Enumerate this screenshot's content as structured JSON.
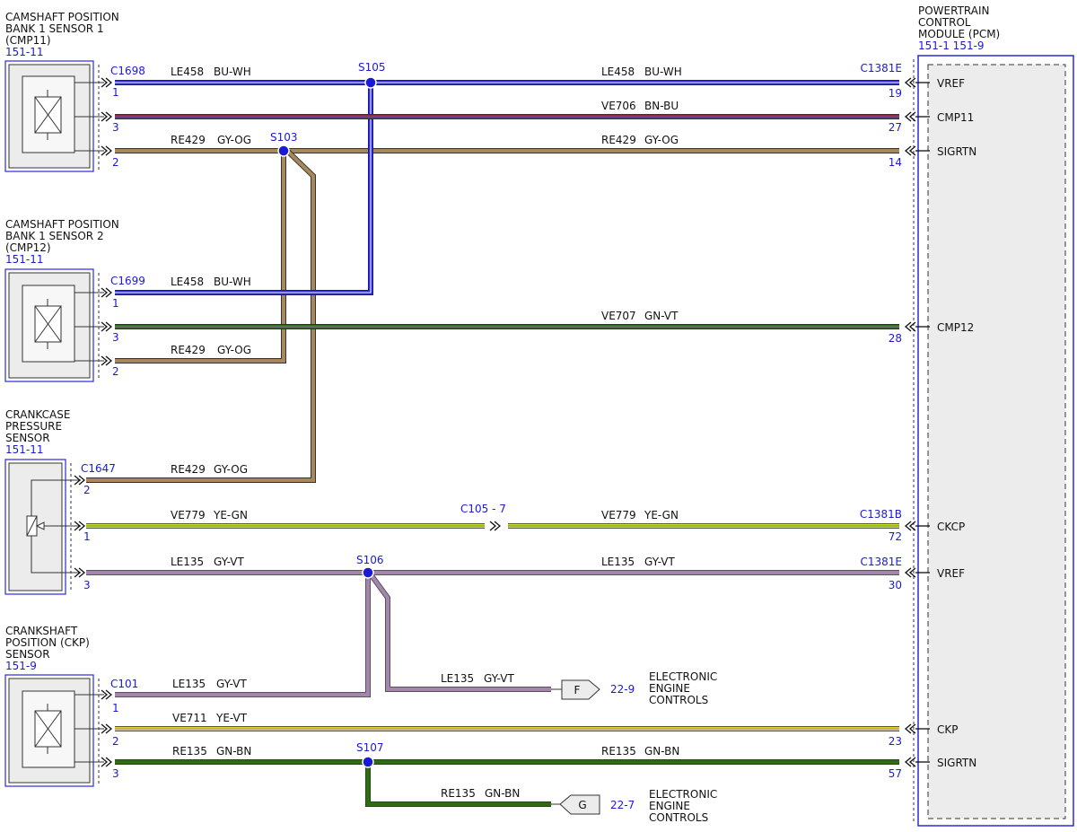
{
  "components": {
    "cmp11": {
      "name": [
        "CAMSHAFT POSITION",
        "BANK 1 SENSOR 1",
        "(CMP11)"
      ],
      "ref": "151-11",
      "connector": "C1698"
    },
    "cmp12": {
      "name": [
        "CAMSHAFT POSITION",
        "BANK 1 SENSOR 2",
        "(CMP12)"
      ],
      "ref": "151-11",
      "connector": "C1699"
    },
    "ccp": {
      "name": [
        "CRANKCASE",
        "PRESSURE",
        "SENSOR"
      ],
      "ref": "151-11",
      "connector": "C1647"
    },
    "ckp": {
      "name": [
        "CRANKSHAFT",
        "POSITION (CKP)",
        "SENSOR"
      ],
      "ref": "151-9",
      "connector": "C101"
    },
    "pcm": {
      "name": [
        "POWERTRAIN",
        "CONTROL",
        "MODULE (PCM)"
      ],
      "ref": "151-1  151-9",
      "connectors": {
        "top": "C1381E",
        "ckcp": "C1381B",
        "vref2": "C1381E"
      }
    }
  },
  "pcm_pins": [
    {
      "label": "VREF",
      "pin": "19"
    },
    {
      "label": "CMP11",
      "pin": "27"
    },
    {
      "label": "SIGRTN",
      "pin": "14"
    },
    {
      "label": "CMP12",
      "pin": "28"
    },
    {
      "label": "CKCP",
      "pin": "72"
    },
    {
      "label": "VREF",
      "pin": "30"
    },
    {
      "label": "CKP",
      "pin": "23"
    },
    {
      "label": "SIGRTN",
      "pin": "57"
    }
  ],
  "sensor_pins": {
    "cmp11": [
      "1",
      "3",
      "2"
    ],
    "cmp12": [
      "1",
      "3",
      "2"
    ],
    "ccp": [
      "2",
      "1",
      "3"
    ],
    "ckp": [
      "1",
      "2",
      "3"
    ]
  },
  "splices": [
    "S105",
    "S103",
    "S106",
    "S107"
  ],
  "inline_connector": "C105  -  7",
  "wires": {
    "le458": {
      "circuit": "LE458",
      "color": "BU-WH"
    },
    "ve706": {
      "circuit": "VE706",
      "color": "BN-BU"
    },
    "re429": {
      "circuit": "RE429",
      "color": "GY-OG"
    },
    "ve707": {
      "circuit": "VE707",
      "color": "GN-VT"
    },
    "ve779": {
      "circuit": "VE779",
      "color": "YE-GN"
    },
    "le135": {
      "circuit": "LE135",
      "color": "GY-VT"
    },
    "ve711": {
      "circuit": "VE711",
      "color": "YE-VT"
    },
    "re135": {
      "circuit": "RE135",
      "color": "GN-BN"
    }
  },
  "offpage": [
    {
      "letter": "F",
      "ref": "22-9",
      "dest": [
        "ELECTRONIC",
        "ENGINE",
        "CONTROLS"
      ]
    },
    {
      "letter": "G",
      "ref": "22-7",
      "dest": [
        "ELECTRONIC",
        "ENGINE",
        "CONTROLS"
      ]
    }
  ],
  "wire_colors": {
    "bu_wh": "#2a2ad8",
    "bn_bu": "#8e2a44",
    "gy_og": "#a8875a",
    "gn_vt": "#2e6e1e",
    "ye_gn": "#d8dc2a",
    "gy_vt": "#a585b0",
    "ye_vt": "#dcd02a",
    "gn_bn": "#2f6a14",
    "module_outline": "#2a2ad8",
    "ref_text": "#1a1ad6"
  }
}
